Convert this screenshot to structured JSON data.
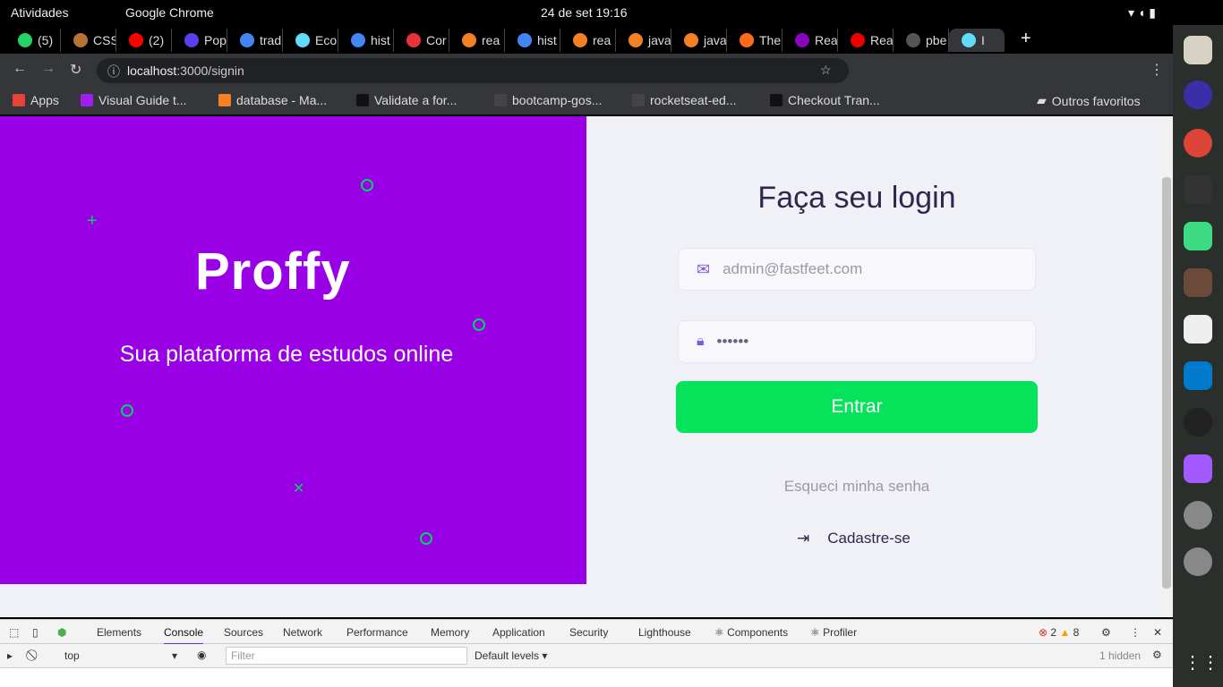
{
  "system": {
    "activities": "Atividades",
    "app": "Google Chrome",
    "datetime": "24 de set  19:16"
  },
  "tabs": [
    {
      "label": "(5)",
      "color": "#25d366"
    },
    {
      "label": "CSS",
      "color": "#b87333"
    },
    {
      "label": "(2)",
      "color": "#ff0000"
    },
    {
      "label": "Pop",
      "color": "#5a3ff0"
    },
    {
      "label": "trad",
      "color": "#4285f4"
    },
    {
      "label": "Eco",
      "color": "#61dafb"
    },
    {
      "label": "hist",
      "color": "#4285f4"
    },
    {
      "label": "Cor",
      "color": "#e8323c"
    },
    {
      "label": "rea",
      "color": "#f48024"
    },
    {
      "label": "hist",
      "color": "#4285f4"
    },
    {
      "label": "rea",
      "color": "#f48024"
    },
    {
      "label": "java",
      "color": "#f48024"
    },
    {
      "label": "java",
      "color": "#f48024"
    },
    {
      "label": "The",
      "color": "#ff6b1a"
    },
    {
      "label": "Rea",
      "color": "#8a05be"
    },
    {
      "label": "Rea",
      "color": "#e00"
    },
    {
      "label": "pbe",
      "color": "#555"
    },
    {
      "label": "I",
      "color": "#61dafb"
    }
  ],
  "address": {
    "host": "localhost",
    "path": ":3000/signin"
  },
  "bookmarks": [
    {
      "label": "Apps",
      "color": "#e94235"
    },
    {
      "label": "Visual Guide t...",
      "color": "#a020f0"
    },
    {
      "label": "database - Ma...",
      "color": "#f48024"
    },
    {
      "label": "Validate a for...",
      "color": "#111"
    },
    {
      "label": "bootcamp-gos...",
      "color": "#444"
    },
    {
      "label": "rocketseat-ed...",
      "color": "#444"
    },
    {
      "label": "Checkout Tran...",
      "color": "#111"
    }
  ],
  "bookmarks_other": "Outros favoritos",
  "hero": {
    "logo": "Proffy",
    "tagline": "Sua plataforma de estudos online",
    "bg": "#9a00e6",
    "accent": "#04d361"
  },
  "login": {
    "title": "Faça seu login",
    "email_placeholder": "admin@fastfeet.com",
    "password_value": "••••••",
    "submit": "Entrar",
    "forgot": "Esqueci minha senha",
    "signup": "Cadastre-se",
    "button_color": "#04e35a"
  },
  "devtools": {
    "tabs": [
      "Elements",
      "Console",
      "Sources",
      "Network",
      "Performance",
      "Memory",
      "Application",
      "Security",
      "Lighthouse",
      "⚛ Components",
      "⚛ Profiler"
    ],
    "active": "Console",
    "errors": "2",
    "warnings": "8",
    "context": "top",
    "filter_placeholder": "Filter",
    "levels": "Default levels ▾",
    "hidden": "1 hidden"
  }
}
